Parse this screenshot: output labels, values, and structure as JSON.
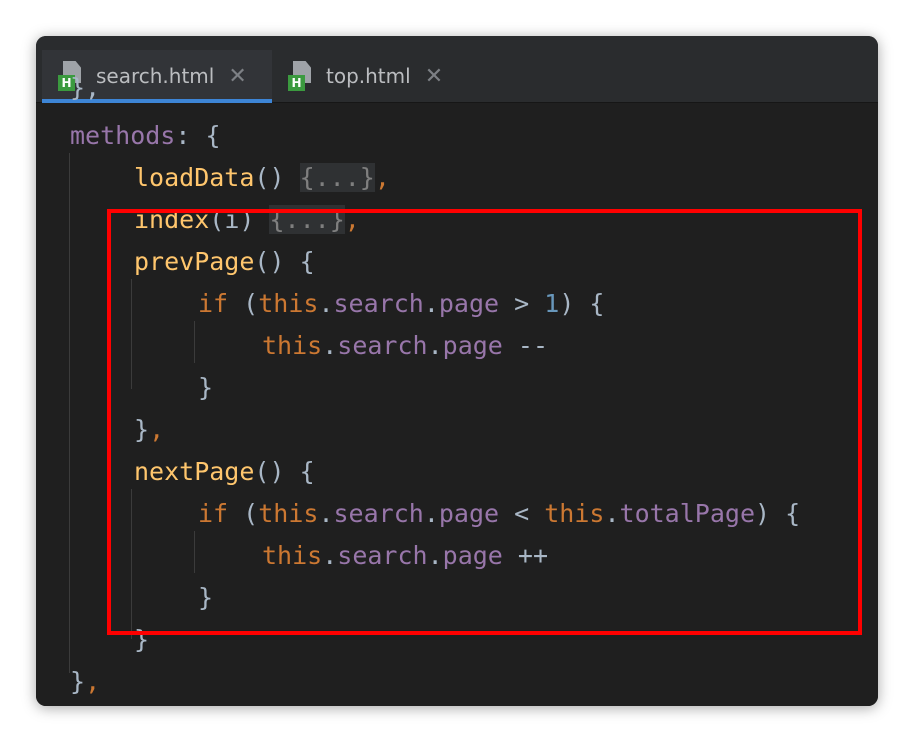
{
  "tabs": [
    {
      "label": "search.html",
      "active": true,
      "badge": "H"
    },
    {
      "label": "top.html",
      "active": false,
      "badge": "H"
    }
  ],
  "close_glyph": "✕",
  "code": {
    "hidden_top": "},",
    "l1_key": "methods",
    "l1_rest": ": {",
    "l2_fn": "loadData",
    "l2_paren": "() ",
    "l2_fold": "{...}",
    "l2_comma": ",",
    "l3_fn": "index",
    "l3_paren": "(i) ",
    "l3_fold": "{...}",
    "l3_comma": ",",
    "l4_fn": "prevPage",
    "l4_rest": "() {",
    "l5_if": "if",
    "l5_open": " (",
    "l5_this": "this",
    "l5_dot1": ".",
    "l5_search": "search",
    "l5_dot2": ".",
    "l5_page": "page",
    "l5_op": " > ",
    "l5_num": "1",
    "l5_close": ") {",
    "l6_this": "this",
    "l6_dot1": ".",
    "l6_search": "search",
    "l6_dot2": ".",
    "l6_page": "page",
    "l6_op": " --",
    "l7": "}",
    "l8_brace": "}",
    "l8_comma": ",",
    "l9_fn": "nextPage",
    "l9_rest": "() {",
    "l10_if": "if",
    "l10_open": " (",
    "l10_this": "this",
    "l10_dot1": ".",
    "l10_search": "search",
    "l10_dot2": ".",
    "l10_page": "page",
    "l10_op": " < ",
    "l10_this2": "this",
    "l10_dot3": ".",
    "l10_total": "totalPage",
    "l10_close": ") {",
    "l11_this": "this",
    "l11_dot1": ".",
    "l11_search": "search",
    "l11_dot2": ".",
    "l11_page": "page",
    "l11_op": " ++",
    "l12": "}",
    "l13": "}",
    "l14_brace": "}",
    "l14_comma": ","
  },
  "colors": {
    "keyword": "#cc7832",
    "function": "#ffc66d",
    "property": "#9876aa",
    "number": "#6897bb",
    "text": "#a9b7c6",
    "highlight": "#ff0000",
    "tab_underline": "#3d85d6"
  },
  "icons": [
    "html-file-icon",
    "close-icon"
  ]
}
